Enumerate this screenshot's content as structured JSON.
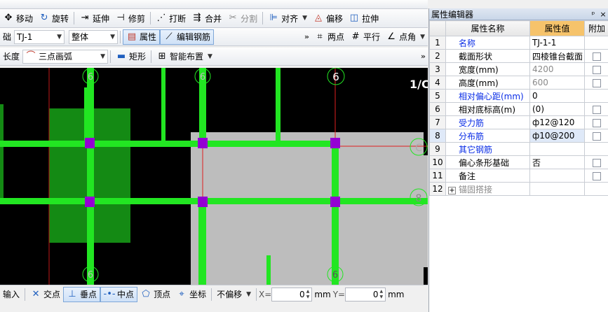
{
  "toolbar_top": {
    "items": [
      {
        "label": "移动",
        "icon": "move-icon"
      },
      {
        "label": "旋转",
        "icon": "rotate-icon"
      },
      {
        "label": "延伸",
        "icon": "extend-icon"
      },
      {
        "label": "修剪",
        "icon": "trim-icon"
      },
      {
        "label": "打断",
        "icon": "break-icon"
      },
      {
        "label": "合并",
        "icon": "merge-icon"
      },
      {
        "label": "分割",
        "icon": "split-icon"
      },
      {
        "label": "对齐",
        "icon": "align-icon"
      },
      {
        "label": "偏移",
        "icon": "offset-icon"
      },
      {
        "label": "拉伸",
        "icon": "stretch-icon"
      }
    ]
  },
  "toolbar_mid": {
    "partial_label": "础",
    "component_select": "TJ-1",
    "whole_select": "整体",
    "property_button": "属性",
    "edit_rebar_button": "编辑钢筋",
    "two_point": "两点",
    "parallel": "平行",
    "point_angle": "点角"
  },
  "toolbar_low": {
    "partial_label": "长度",
    "arc_select": "三点画弧",
    "rect_button": "矩形",
    "smart_layout": "智能布置"
  },
  "canvas": {
    "axis_labels": [
      "6",
      "6",
      "C",
      "8",
      "6",
      "6",
      "6"
    ],
    "corner_text": "1/C"
  },
  "statusbar": {
    "input_label": "输入",
    "intersection": "交点",
    "perpendicular": "垂点",
    "midpoint": "中点",
    "vertex": "顶点",
    "coordinate": "坐标",
    "no_offset": "不偏移",
    "x_label": "X=",
    "x_value": "0",
    "y_label": "Y=",
    "y_value": "0",
    "unit": "mm"
  },
  "panel": {
    "title": "属性编辑器",
    "headers": {
      "name": "属性名称",
      "value": "属性值",
      "extra": "附加"
    },
    "rows": [
      {
        "idx": "1",
        "name": "名称",
        "value": "TJ-1-1",
        "blue": true,
        "checkbox": false,
        "gray": false
      },
      {
        "idx": "2",
        "name": "截面形状",
        "value": "四棱锥台截面",
        "blue": false,
        "checkbox": true,
        "gray": false
      },
      {
        "idx": "3",
        "name": "宽度(mm)",
        "value": "4200",
        "blue": false,
        "checkbox": true,
        "gray": true
      },
      {
        "idx": "4",
        "name": "高度(mm)",
        "value": "600",
        "blue": false,
        "checkbox": true,
        "gray": true
      },
      {
        "idx": "5",
        "name": "相对偏心距(mm)",
        "value": "0",
        "blue": true,
        "checkbox": false,
        "gray": false
      },
      {
        "idx": "6",
        "name": "相对底标高(m)",
        "value": "(0)",
        "blue": false,
        "checkbox": true,
        "gray": false
      },
      {
        "idx": "7",
        "name": "受力筋",
        "value": "ф12@120",
        "blue": true,
        "checkbox": true,
        "gray": false
      },
      {
        "idx": "8",
        "name": "分布筋",
        "value": "ф10@200",
        "blue": true,
        "checkbox": true,
        "gray": false
      },
      {
        "idx": "9",
        "name": "其它钢筋",
        "value": "",
        "blue": true,
        "checkbox": false,
        "gray": false
      },
      {
        "idx": "10",
        "name": "偏心条形基础",
        "value": "否",
        "blue": false,
        "checkbox": true,
        "gray": false
      },
      {
        "idx": "11",
        "name": "备注",
        "value": "",
        "blue": false,
        "checkbox": true,
        "gray": false
      },
      {
        "idx": "12",
        "name": "锚固搭接",
        "value": "",
        "blue": false,
        "checkbox": false,
        "gray": true,
        "expand": true
      }
    ]
  }
}
